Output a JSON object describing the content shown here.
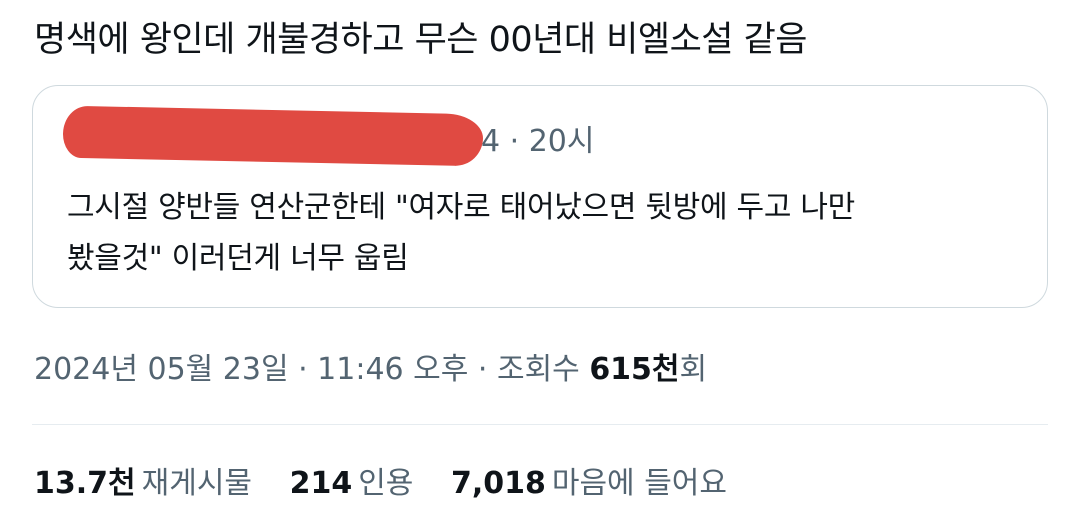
{
  "tweet": {
    "text": "명색에 왕인데 개불경하고 무슨 00년대 비엘소설 같음"
  },
  "quote": {
    "meta": "4 · 20시",
    "body": "그시절 양반들 연산군한테 \"여자로 태어났으면 뒷방에 두고 나만\n봤을것\" 이러던게 너무 웁림",
    "redaction_color": "#e04a42"
  },
  "timestamp": {
    "date_time": "2024년 05월 23일 · 11:46 오후 · 조회수 ",
    "views_num": "615천",
    "views_suffix": "회"
  },
  "stats": {
    "retweets": {
      "num": "13.7천",
      "label": "재게시물"
    },
    "quotes": {
      "num": "214",
      "label": "인용"
    },
    "likes": {
      "num": "7,018",
      "label": "마음에 들어요"
    }
  },
  "colors": {
    "text": "#0f1419",
    "secondary": "#536471",
    "border": "#cfd9de"
  }
}
